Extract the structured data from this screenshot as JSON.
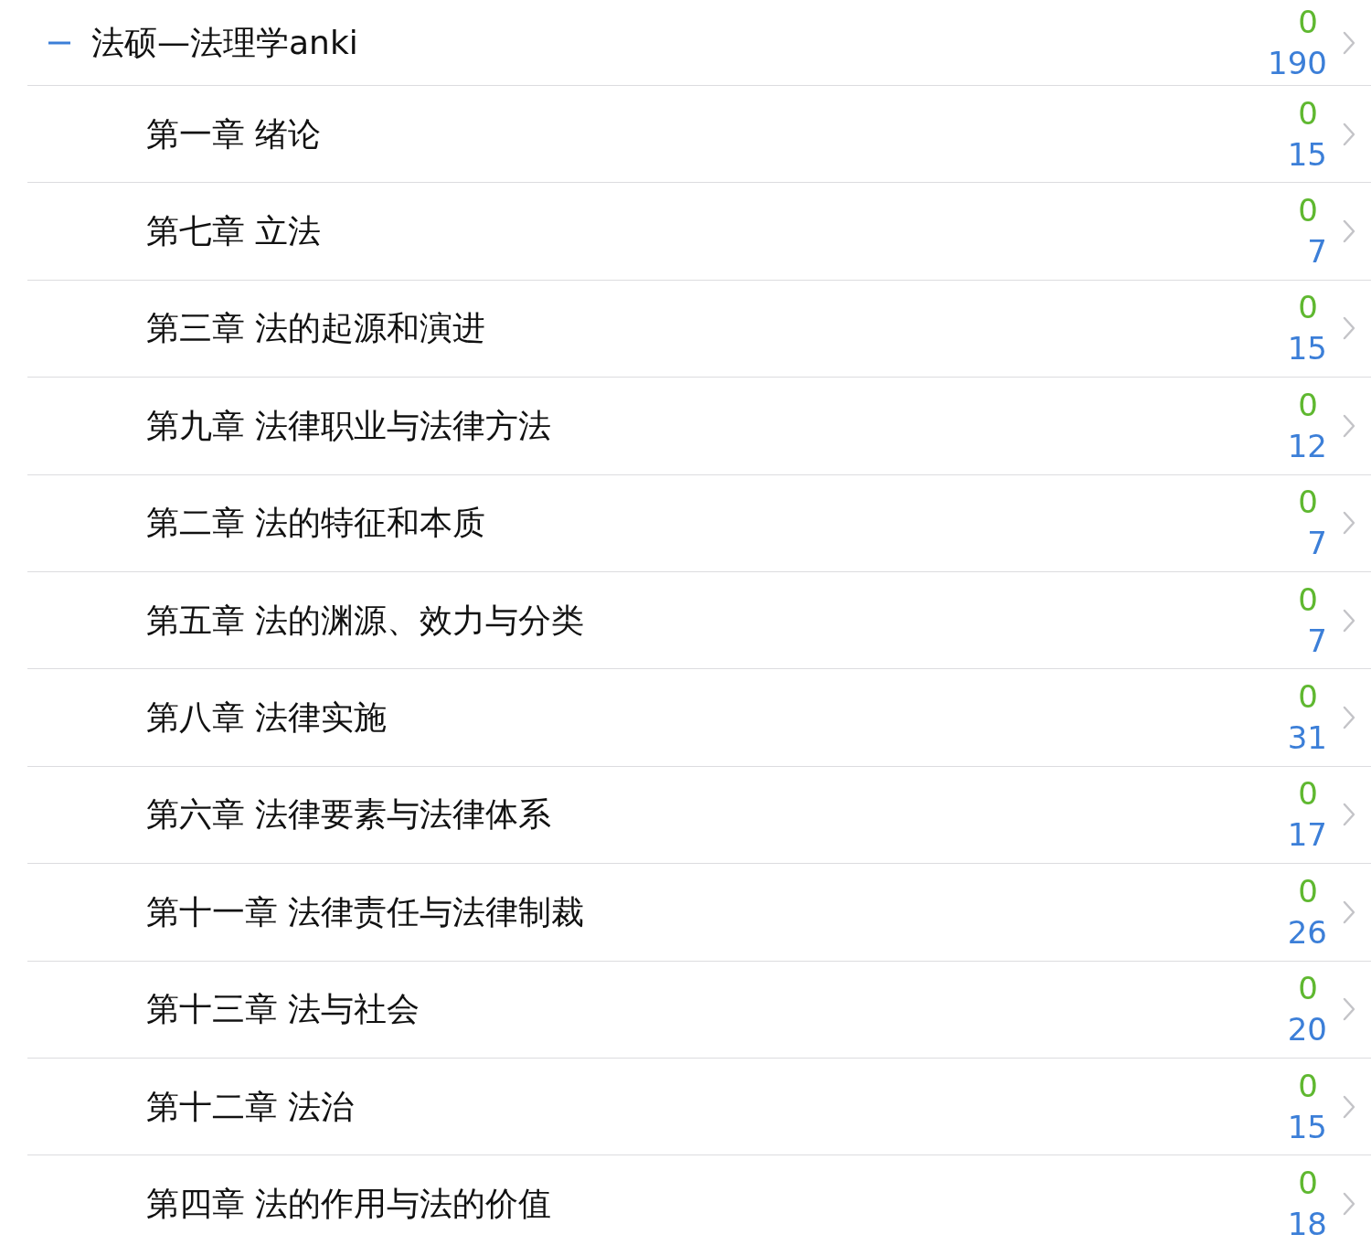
{
  "deck": {
    "title": "法硕—法理学anki",
    "expanded": true,
    "new_count": "0",
    "due_count": "190",
    "children": [
      {
        "title": "第一章 绪论",
        "new_count": "0",
        "due_count": "15"
      },
      {
        "title": "第七章 立法",
        "new_count": "0",
        "due_count": "7"
      },
      {
        "title": "第三章 法的起源和演进",
        "new_count": "0",
        "due_count": "15"
      },
      {
        "title": "第九章 法律职业与法律方法",
        "new_count": "0",
        "due_count": "12"
      },
      {
        "title": "第二章 法的特征和本质",
        "new_count": "0",
        "due_count": "7"
      },
      {
        "title": "第五章 法的渊源、效力与分类",
        "new_count": "0",
        "due_count": "7"
      },
      {
        "title": "第八章 法律实施",
        "new_count": "0",
        "due_count": "31"
      },
      {
        "title": "第六章 法律要素与法律体系",
        "new_count": "0",
        "due_count": "17"
      },
      {
        "title": "第十一章 法律责任与法律制裁",
        "new_count": "0",
        "due_count": "26"
      },
      {
        "title": "第十三章 法与社会",
        "new_count": "0",
        "due_count": "20"
      },
      {
        "title": "第十二章 法治",
        "new_count": "0",
        "due_count": "15"
      },
      {
        "title": "第四章 法的作用与法的价值",
        "new_count": "0",
        "due_count": "18"
      }
    ]
  }
}
